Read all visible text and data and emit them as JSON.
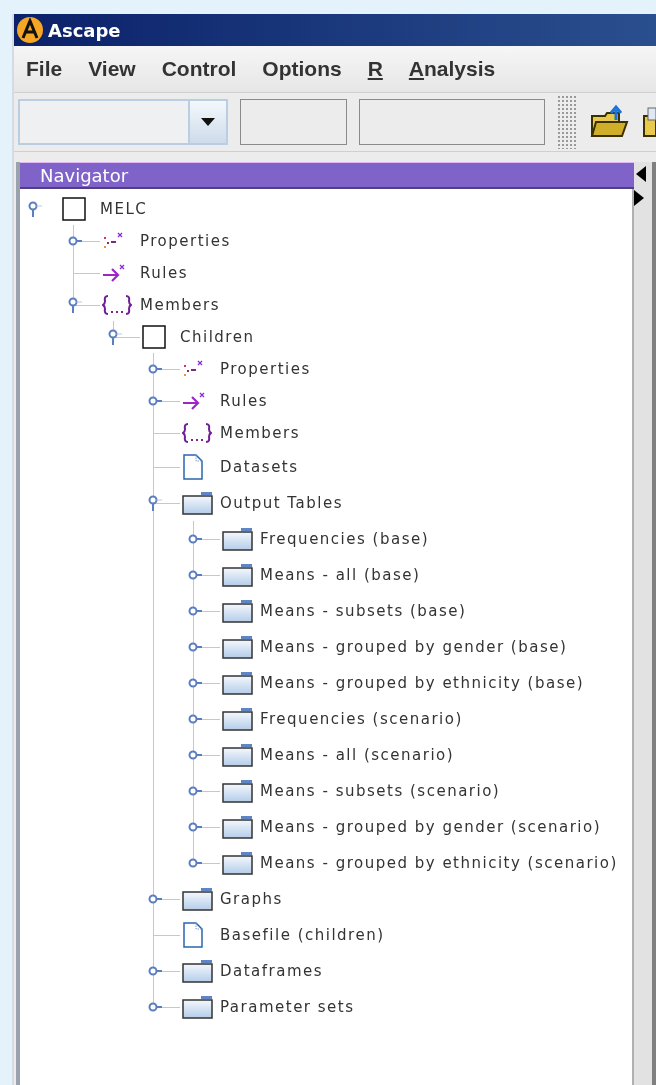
{
  "window": {
    "title": "Ascape"
  },
  "menu": [
    {
      "label": "File",
      "mnemonic": false
    },
    {
      "label": "View",
      "mnemonic": false
    },
    {
      "label": "Control",
      "mnemonic": false
    },
    {
      "label": "Options",
      "mnemonic": false
    },
    {
      "label": "R",
      "mnemonic": true
    },
    {
      "label": "Analysis",
      "mnemonic": true
    }
  ],
  "navigator": {
    "title": "Navigator",
    "tree": [
      {
        "label": "MELC",
        "kind": "agent",
        "leaf": false,
        "expanded": true,
        "children": [
          {
            "label": "Properties",
            "kind": "properties",
            "leaf": false,
            "expanded": false
          },
          {
            "label": "Rules",
            "kind": "rules",
            "leaf": true
          },
          {
            "label": "Members",
            "kind": "members",
            "leaf": false,
            "expanded": true,
            "children": [
              {
                "label": "Children",
                "kind": "agent",
                "leaf": false,
                "expanded": true,
                "children": [
                  {
                    "label": "Properties",
                    "kind": "properties",
                    "leaf": false,
                    "expanded": false
                  },
                  {
                    "label": "Rules",
                    "kind": "rules",
                    "leaf": false,
                    "expanded": false
                  },
                  {
                    "label": "Members",
                    "kind": "members",
                    "leaf": true
                  },
                  {
                    "label": "Datasets",
                    "kind": "file",
                    "leaf": true
                  },
                  {
                    "label": "Output Tables",
                    "kind": "folder",
                    "leaf": false,
                    "expanded": true,
                    "children": [
                      {
                        "label": "Frequencies (base)",
                        "kind": "folder",
                        "leaf": false,
                        "expanded": false
                      },
                      {
                        "label": "Means - all (base)",
                        "kind": "folder",
                        "leaf": false,
                        "expanded": false
                      },
                      {
                        "label": "Means - subsets (base)",
                        "kind": "folder",
                        "leaf": false,
                        "expanded": false
                      },
                      {
                        "label": "Means - grouped by gender (base)",
                        "kind": "folder",
                        "leaf": false,
                        "expanded": false
                      },
                      {
                        "label": "Means - grouped by ethnicity (base)",
                        "kind": "folder",
                        "leaf": false,
                        "expanded": false
                      },
                      {
                        "label": "Frequencies (scenario)",
                        "kind": "folder",
                        "leaf": false,
                        "expanded": false
                      },
                      {
                        "label": "Means - all (scenario)",
                        "kind": "folder",
                        "leaf": false,
                        "expanded": false
                      },
                      {
                        "label": "Means - subsets (scenario)",
                        "kind": "folder",
                        "leaf": false,
                        "expanded": false
                      },
                      {
                        "label": "Means - grouped by gender (scenario)",
                        "kind": "folder",
                        "leaf": false,
                        "expanded": false
                      },
                      {
                        "label": "Means - grouped by ethnicity (scenario)",
                        "kind": "folder",
                        "leaf": false,
                        "expanded": false
                      }
                    ]
                  },
                  {
                    "label": "Graphs",
                    "kind": "folder",
                    "leaf": false,
                    "expanded": false
                  },
                  {
                    "label": "Basefile (children)",
                    "kind": "file",
                    "leaf": true
                  },
                  {
                    "label": "Dataframes",
                    "kind": "folder",
                    "leaf": false,
                    "expanded": false
                  },
                  {
                    "label": "Parameter sets",
                    "kind": "folder",
                    "leaf": false,
                    "expanded": false
                  }
                ]
              }
            ]
          }
        ]
      }
    ]
  }
}
